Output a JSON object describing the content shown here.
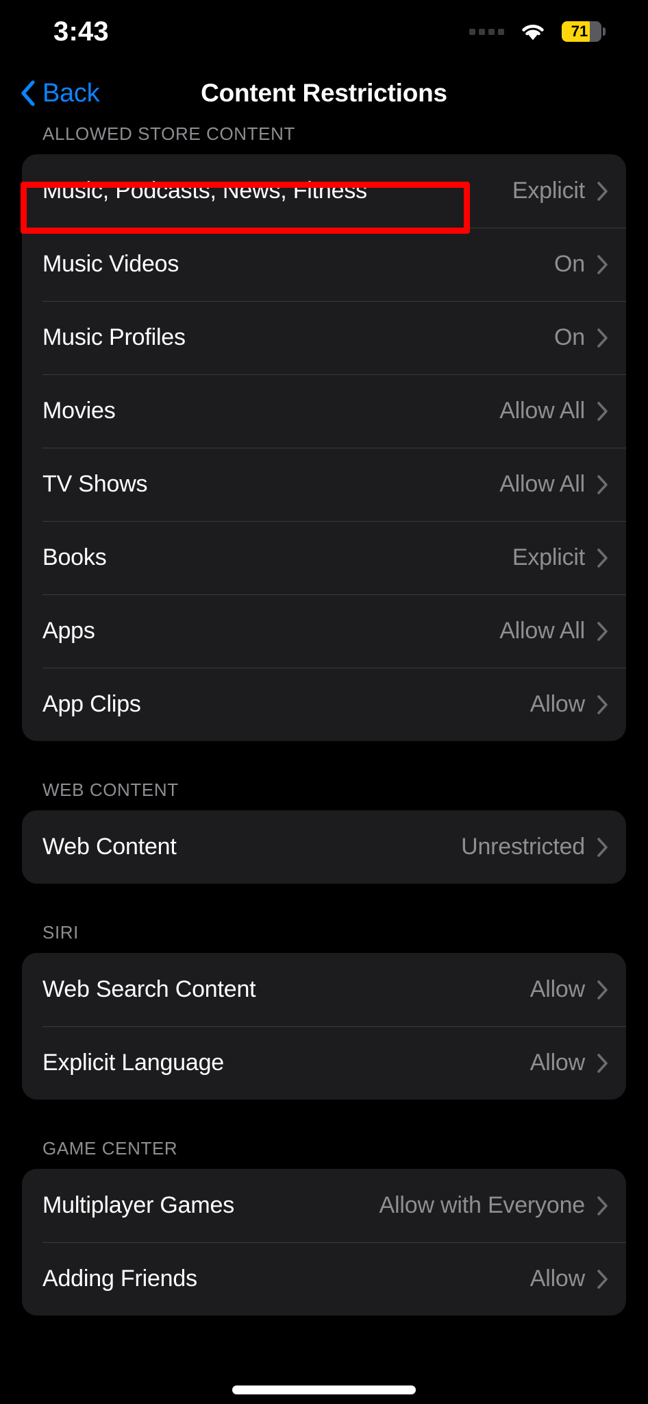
{
  "status_bar": {
    "time": "3:43",
    "signal_icon": "signal-dots-icon",
    "wifi_icon": "wifi-icon",
    "battery_percent": "71",
    "battery_level": 71,
    "battery_color": "#FFD60A"
  },
  "nav": {
    "back_label": "Back",
    "back_icon": "chevron-left-icon",
    "title": "Content Restrictions",
    "accent_color": "#0A84FF"
  },
  "sections": [
    {
      "header": "ALLOWED STORE CONTENT",
      "rows": [
        {
          "label": "Music, Podcasts, News, Fitness",
          "value": "Explicit"
        },
        {
          "label": "Music Videos",
          "value": "On"
        },
        {
          "label": "Music Profiles",
          "value": "On"
        },
        {
          "label": "Movies",
          "value": "Allow All"
        },
        {
          "label": "TV Shows",
          "value": "Allow All"
        },
        {
          "label": "Books",
          "value": "Explicit"
        },
        {
          "label": "Apps",
          "value": "Allow All"
        },
        {
          "label": "App Clips",
          "value": "Allow"
        }
      ]
    },
    {
      "header": "WEB CONTENT",
      "rows": [
        {
          "label": "Web Content",
          "value": "Unrestricted"
        }
      ]
    },
    {
      "header": "SIRI",
      "rows": [
        {
          "label": "Web Search Content",
          "value": "Allow"
        },
        {
          "label": "Explicit Language",
          "value": "Allow"
        }
      ]
    },
    {
      "header": "GAME CENTER",
      "rows": [
        {
          "label": "Multiplayer Games",
          "value": "Allow with Everyone"
        },
        {
          "label": "Adding Friends",
          "value": "Allow"
        }
      ]
    }
  ],
  "annotation": {
    "highlight_color": "#FF0000",
    "target": "Music, Podcasts, News, Fitness"
  },
  "theme": {
    "background": "#000000",
    "card_background": "#1C1C1E",
    "separator": "#3A3A3C",
    "primary_text": "#FFFFFF",
    "secondary_text": "#8E8E93"
  }
}
